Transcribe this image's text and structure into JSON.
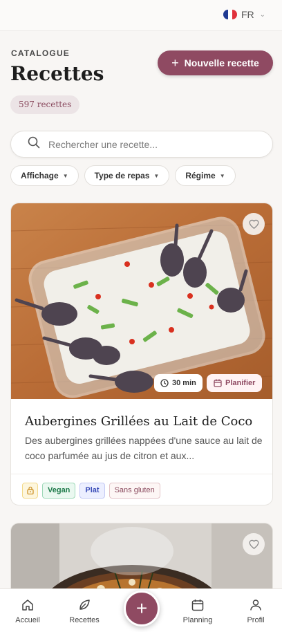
{
  "topbar": {
    "language": "FR",
    "flag_colors": [
      "#1f3a93",
      "#ffffff",
      "#e0313c"
    ]
  },
  "header": {
    "eyebrow": "CATALOGUE",
    "title": "Recettes",
    "count_label": "597 recettes",
    "new_button_label": "Nouvelle recette"
  },
  "search": {
    "placeholder": "Rechercher une recette...",
    "value": ""
  },
  "filters": [
    {
      "label": "Affichage"
    },
    {
      "label": "Type de repas"
    },
    {
      "label": "Régime"
    }
  ],
  "recipes": [
    {
      "title": "Aubergines Grillées au Lait de Coco",
      "description": "Des aubergines grillées nappées d'une sauce au lait de coco parfumée au jus de citron et aux...",
      "time": "30 min",
      "plan_label": "Planifier",
      "tags": [
        "Vegan",
        "Plat",
        "Sans gluten"
      ],
      "favorite": false
    },
    {
      "favorite": false
    }
  ],
  "nav": {
    "items": [
      {
        "label": "Accueil",
        "icon": "home-icon"
      },
      {
        "label": "Recettes",
        "icon": "leaf-icon"
      },
      {
        "label": "Planning",
        "icon": "calendar-icon"
      },
      {
        "label": "Profil",
        "icon": "user-icon"
      }
    ],
    "fab_icon": "plus-icon"
  },
  "colors": {
    "accent": "#8f4a62",
    "background": "#f8f6f4"
  }
}
